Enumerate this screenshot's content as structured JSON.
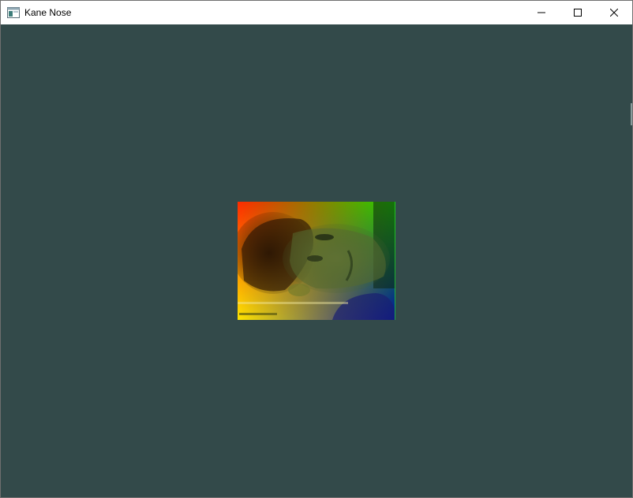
{
  "window": {
    "title": "Kane Nose",
    "icon": "app-window-icon",
    "controls": {
      "minimize": "minimize-icon",
      "maximize": "maximize-icon",
      "close": "close-icon"
    }
  },
  "canvas": {
    "background_color": "#334a4a",
    "texture_gradient": {
      "top_left": "#ff2a00",
      "top_right": "#1ed400",
      "bottom_left": "#ffe600",
      "bottom_right": "#0010a0"
    }
  }
}
